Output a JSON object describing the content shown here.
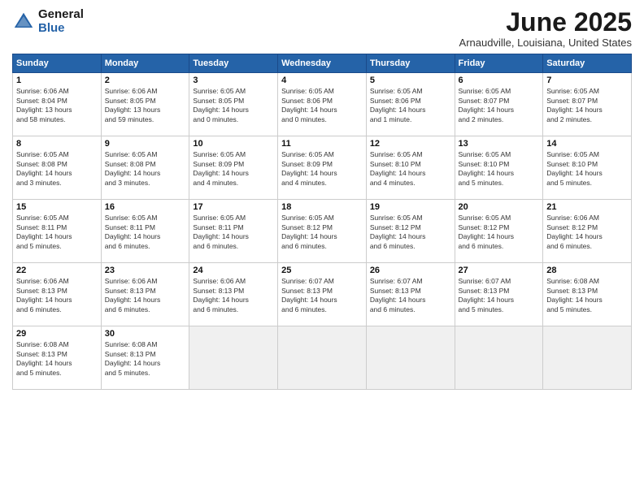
{
  "header": {
    "logo_general": "General",
    "logo_blue": "Blue",
    "month_title": "June 2025",
    "location": "Arnaudville, Louisiana, United States"
  },
  "days_of_week": [
    "Sunday",
    "Monday",
    "Tuesday",
    "Wednesday",
    "Thursday",
    "Friday",
    "Saturday"
  ],
  "weeks": [
    [
      {
        "num": "1",
        "info": "Sunrise: 6:06 AM\nSunset: 8:04 PM\nDaylight: 13 hours\nand 58 minutes."
      },
      {
        "num": "2",
        "info": "Sunrise: 6:06 AM\nSunset: 8:05 PM\nDaylight: 13 hours\nand 59 minutes."
      },
      {
        "num": "3",
        "info": "Sunrise: 6:05 AM\nSunset: 8:05 PM\nDaylight: 14 hours\nand 0 minutes."
      },
      {
        "num": "4",
        "info": "Sunrise: 6:05 AM\nSunset: 8:06 PM\nDaylight: 14 hours\nand 0 minutes."
      },
      {
        "num": "5",
        "info": "Sunrise: 6:05 AM\nSunset: 8:06 PM\nDaylight: 14 hours\nand 1 minute."
      },
      {
        "num": "6",
        "info": "Sunrise: 6:05 AM\nSunset: 8:07 PM\nDaylight: 14 hours\nand 2 minutes."
      },
      {
        "num": "7",
        "info": "Sunrise: 6:05 AM\nSunset: 8:07 PM\nDaylight: 14 hours\nand 2 minutes."
      }
    ],
    [
      {
        "num": "8",
        "info": "Sunrise: 6:05 AM\nSunset: 8:08 PM\nDaylight: 14 hours\nand 3 minutes."
      },
      {
        "num": "9",
        "info": "Sunrise: 6:05 AM\nSunset: 8:08 PM\nDaylight: 14 hours\nand 3 minutes."
      },
      {
        "num": "10",
        "info": "Sunrise: 6:05 AM\nSunset: 8:09 PM\nDaylight: 14 hours\nand 4 minutes."
      },
      {
        "num": "11",
        "info": "Sunrise: 6:05 AM\nSunset: 8:09 PM\nDaylight: 14 hours\nand 4 minutes."
      },
      {
        "num": "12",
        "info": "Sunrise: 6:05 AM\nSunset: 8:10 PM\nDaylight: 14 hours\nand 4 minutes."
      },
      {
        "num": "13",
        "info": "Sunrise: 6:05 AM\nSunset: 8:10 PM\nDaylight: 14 hours\nand 5 minutes."
      },
      {
        "num": "14",
        "info": "Sunrise: 6:05 AM\nSunset: 8:10 PM\nDaylight: 14 hours\nand 5 minutes."
      }
    ],
    [
      {
        "num": "15",
        "info": "Sunrise: 6:05 AM\nSunset: 8:11 PM\nDaylight: 14 hours\nand 5 minutes."
      },
      {
        "num": "16",
        "info": "Sunrise: 6:05 AM\nSunset: 8:11 PM\nDaylight: 14 hours\nand 6 minutes."
      },
      {
        "num": "17",
        "info": "Sunrise: 6:05 AM\nSunset: 8:11 PM\nDaylight: 14 hours\nand 6 minutes."
      },
      {
        "num": "18",
        "info": "Sunrise: 6:05 AM\nSunset: 8:12 PM\nDaylight: 14 hours\nand 6 minutes."
      },
      {
        "num": "19",
        "info": "Sunrise: 6:05 AM\nSunset: 8:12 PM\nDaylight: 14 hours\nand 6 minutes."
      },
      {
        "num": "20",
        "info": "Sunrise: 6:05 AM\nSunset: 8:12 PM\nDaylight: 14 hours\nand 6 minutes."
      },
      {
        "num": "21",
        "info": "Sunrise: 6:06 AM\nSunset: 8:12 PM\nDaylight: 14 hours\nand 6 minutes."
      }
    ],
    [
      {
        "num": "22",
        "info": "Sunrise: 6:06 AM\nSunset: 8:13 PM\nDaylight: 14 hours\nand 6 minutes."
      },
      {
        "num": "23",
        "info": "Sunrise: 6:06 AM\nSunset: 8:13 PM\nDaylight: 14 hours\nand 6 minutes."
      },
      {
        "num": "24",
        "info": "Sunrise: 6:06 AM\nSunset: 8:13 PM\nDaylight: 14 hours\nand 6 minutes."
      },
      {
        "num": "25",
        "info": "Sunrise: 6:07 AM\nSunset: 8:13 PM\nDaylight: 14 hours\nand 6 minutes."
      },
      {
        "num": "26",
        "info": "Sunrise: 6:07 AM\nSunset: 8:13 PM\nDaylight: 14 hours\nand 6 minutes."
      },
      {
        "num": "27",
        "info": "Sunrise: 6:07 AM\nSunset: 8:13 PM\nDaylight: 14 hours\nand 5 minutes."
      },
      {
        "num": "28",
        "info": "Sunrise: 6:08 AM\nSunset: 8:13 PM\nDaylight: 14 hours\nand 5 minutes."
      }
    ],
    [
      {
        "num": "29",
        "info": "Sunrise: 6:08 AM\nSunset: 8:13 PM\nDaylight: 14 hours\nand 5 minutes."
      },
      {
        "num": "30",
        "info": "Sunrise: 6:08 AM\nSunset: 8:13 PM\nDaylight: 14 hours\nand 5 minutes."
      },
      {
        "num": "",
        "info": ""
      },
      {
        "num": "",
        "info": ""
      },
      {
        "num": "",
        "info": ""
      },
      {
        "num": "",
        "info": ""
      },
      {
        "num": "",
        "info": ""
      }
    ]
  ]
}
